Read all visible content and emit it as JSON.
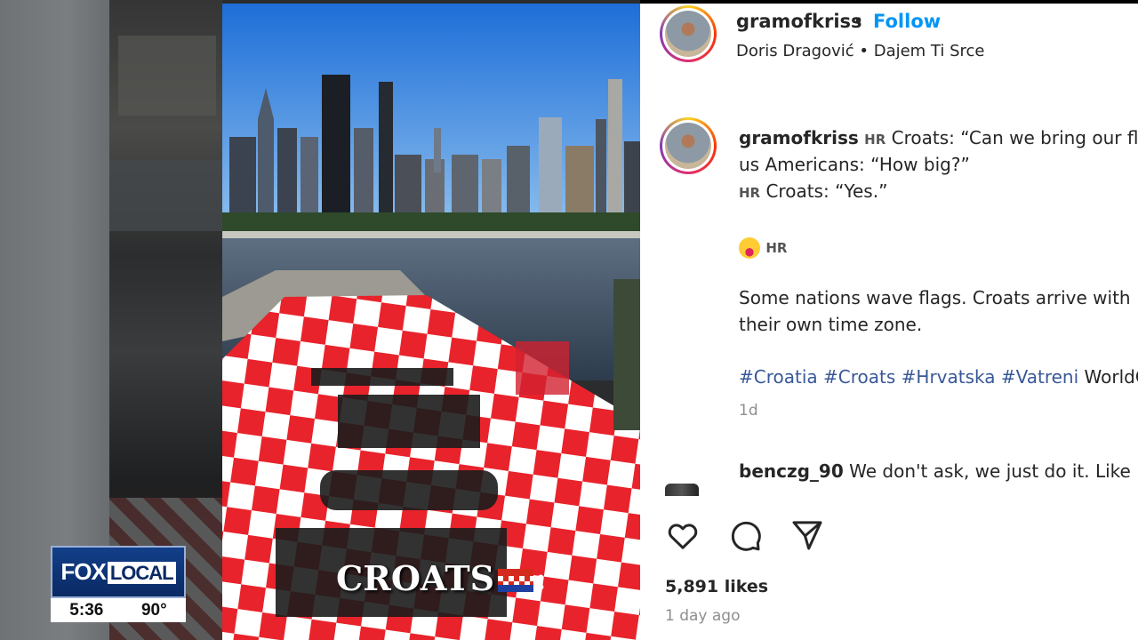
{
  "post": {
    "username": "gramofkriss",
    "separator": "•",
    "follow_label": "Follow",
    "music": "Doris Dragović • Dajem Ti Srce",
    "caption": {
      "username": "gramofkriss",
      "line1_flag": "HR",
      "line1_text": "Croats: “Can we bring our fla",
      "line2_text": "us Americans: “How big?”",
      "line3_flag": "HR",
      "line3_text": "Croats: “Yes.”",
      "line4_flag": "HR",
      "line5_text": "Some nations wave flags. Croats arrive with",
      "line6_text": "their own time zone.",
      "hashtags": [
        "#Croatia",
        "#Croats",
        "#Hrvatska",
        "#Vatreni"
      ],
      "hashtag_tail": "WorldC"
    },
    "timestamp_short": "1d",
    "comment": {
      "username": "benczg_90",
      "text": "We don't ask, we just do it. Like I"
    },
    "likes": "5,891 likes",
    "time_ago": "1 day ago"
  },
  "video": {
    "caption": "CROATS",
    "caption_suffix": ":"
  },
  "broadcast": {
    "logo_fox": "FOX",
    "logo_local": "LOCAL",
    "time": "5:36",
    "temperature": "90°"
  },
  "colors": {
    "follow_blue": "#0095f6",
    "hashtag_blue": "#385898",
    "flag_red": "#d52b1e",
    "fox_blue": "#0a2a63"
  },
  "icons": [
    "heart-icon",
    "comment-icon",
    "share-icon"
  ]
}
